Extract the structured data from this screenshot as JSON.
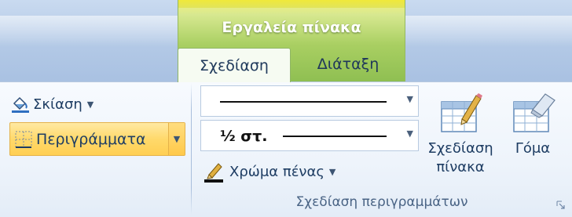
{
  "contextual_tab_group": {
    "title": "Εργαλεία πίνακα"
  },
  "tabs": [
    {
      "label": "Σχεδίαση",
      "active": true
    },
    {
      "label": "Διάταξη",
      "active": false
    }
  ],
  "left_group": {
    "shading": {
      "label": "Σκίαση",
      "icon": "paint-bucket-icon"
    },
    "borders": {
      "label": "Περιγράμματα",
      "icon": "borders-grid-icon",
      "highlighted": true
    }
  },
  "draw_borders_group": {
    "line_style": {
      "value": "solid-line"
    },
    "line_weight": {
      "value": "½ στ."
    },
    "pen_color": {
      "label": "Χρώμα πένας",
      "icon": "pen-color-icon"
    },
    "draw_table": {
      "label_line1": "Σχεδίαση",
      "label_line2": "πίνακα",
      "icon": "draw-table-pencil-icon"
    },
    "eraser": {
      "label": "Γόμα",
      "icon": "eraser-table-icon"
    },
    "group_label": "Σχεδίαση περιγραμμάτων"
  },
  "colors": {
    "context_green": "#a9cf62",
    "highlight_orange": "#ffd96b",
    "ribbon_bg": "#eef4fb"
  }
}
